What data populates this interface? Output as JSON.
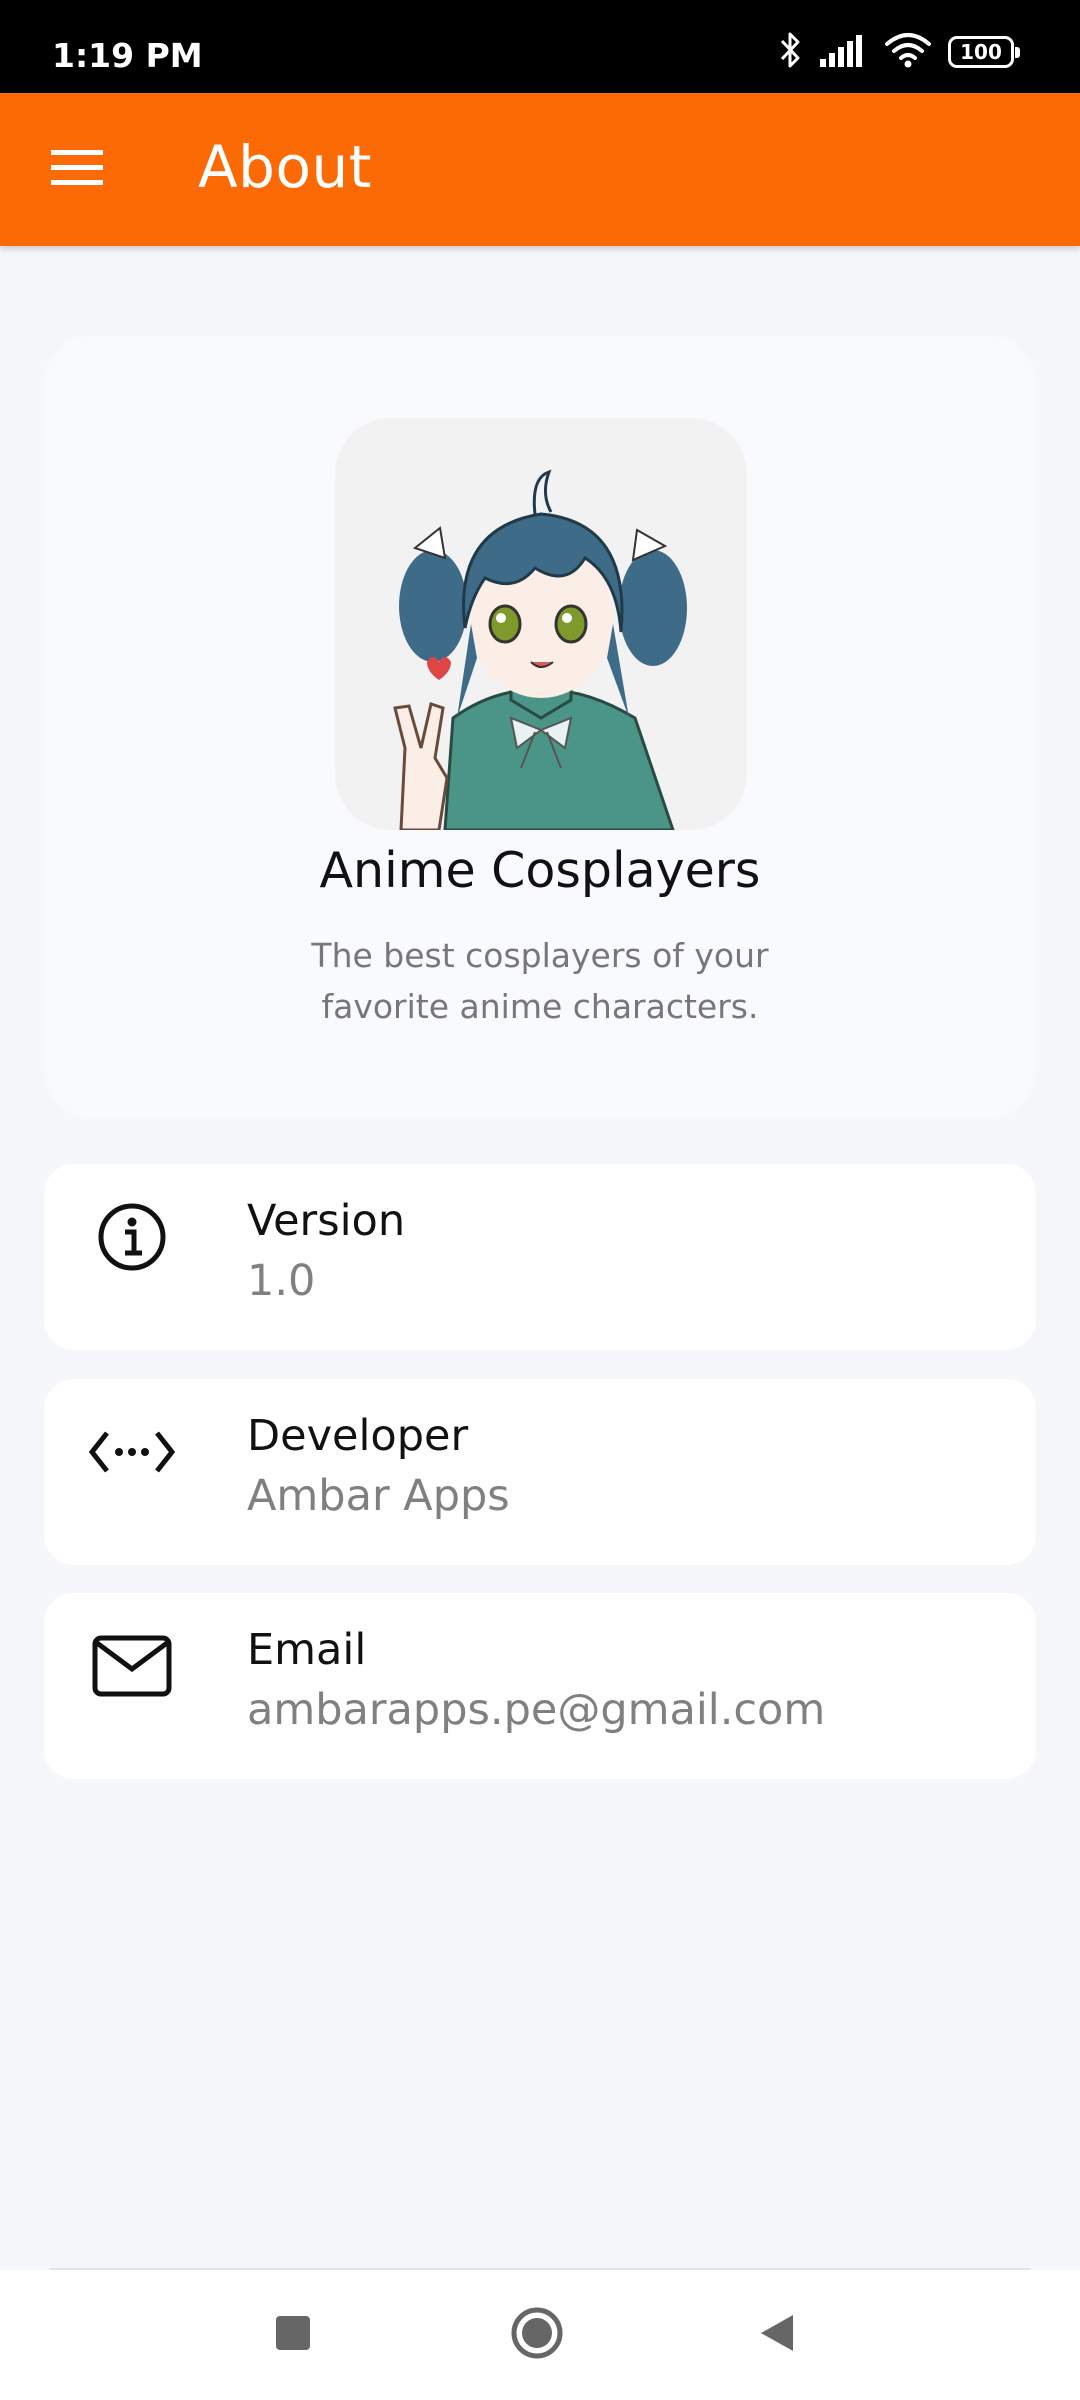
{
  "status_bar": {
    "time": "1:19 PM",
    "battery": "100",
    "icons": [
      "bluetooth-icon",
      "signal-icon",
      "wifi-icon",
      "battery-icon"
    ]
  },
  "app_bar": {
    "title": "About",
    "menu_icon": "menu-icon",
    "color": "#fb6a04"
  },
  "hero": {
    "icon": "anime-girl-app-icon",
    "app_name": "Anime Cosplayers",
    "description": "The best cosplayers of your favorite anime characters."
  },
  "info_items": [
    {
      "icon": "info-icon",
      "label": "Version",
      "value": "1.0"
    },
    {
      "icon": "code-icon",
      "label": "Developer",
      "value": "Ambar Apps"
    },
    {
      "icon": "mail-icon",
      "label": "Email",
      "value": "ambarapps.pe@gmail.com"
    }
  ],
  "nav_bar": {
    "buttons": [
      "recents-icon",
      "home-icon",
      "back-icon"
    ]
  }
}
